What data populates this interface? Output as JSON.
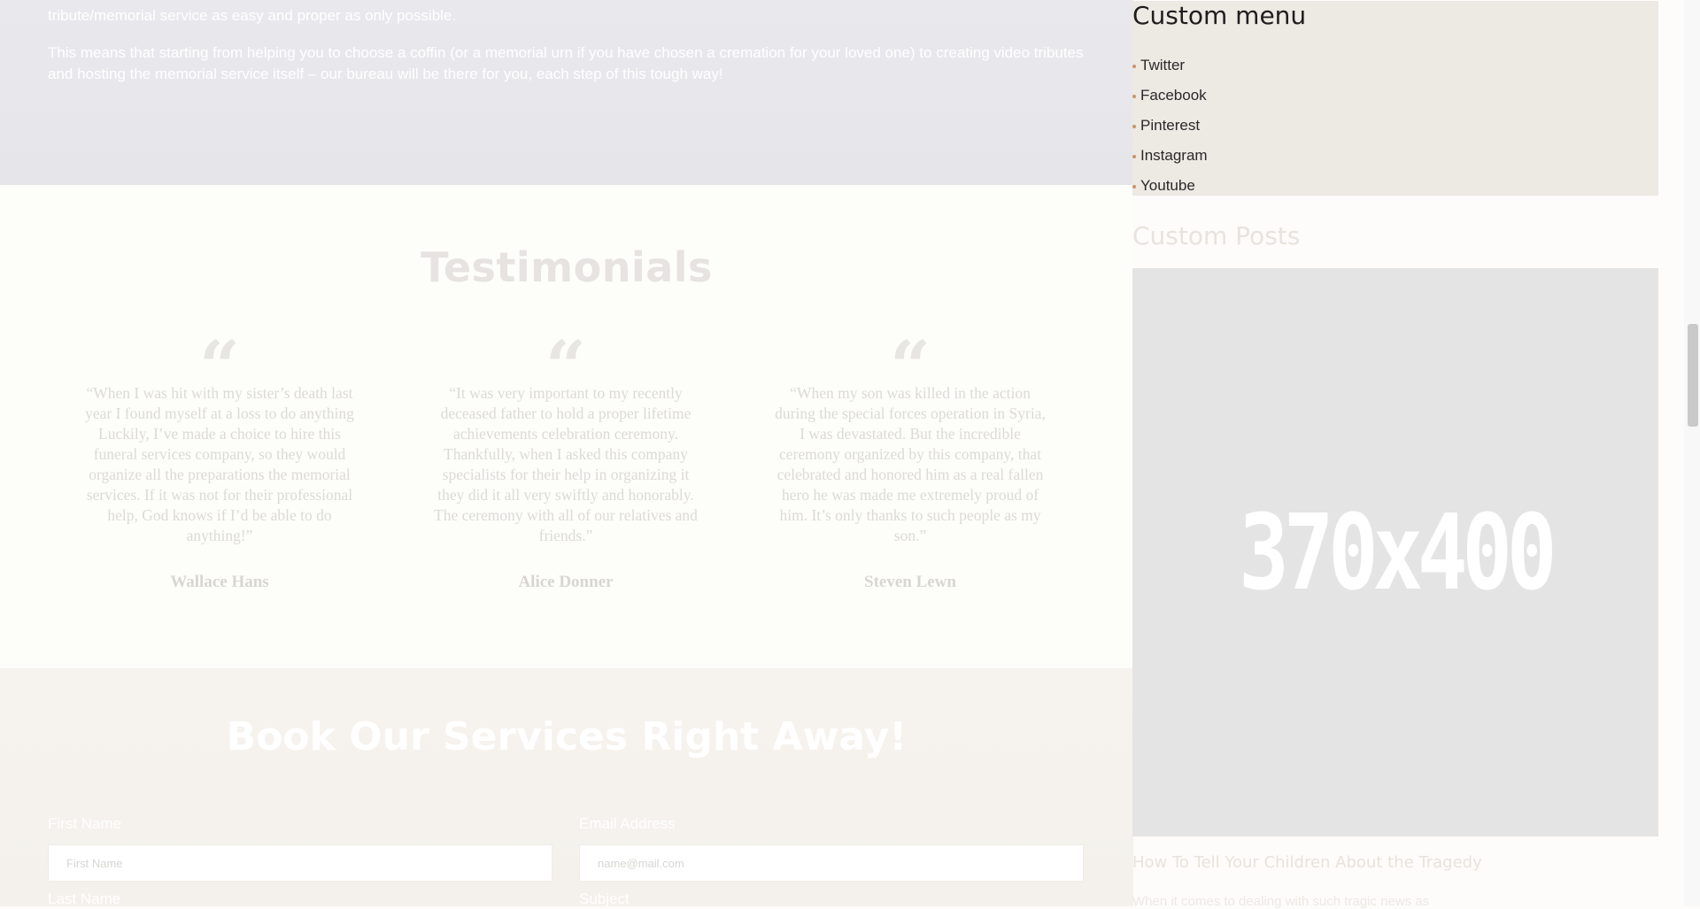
{
  "hero": {
    "paragraph_1": "tribute/memorial service as easy and proper as only possible.",
    "paragraph_2": "This means that starting from helping you to choose a coffin (or a memorial urn if you have chosen a cremation for your loved one) to creating video tributes and hosting the memorial service itself – our bureau will be there for you, each step of this tough way!"
  },
  "testimonials": {
    "title": "Testimonials",
    "quote_icon": "quote-open-icon",
    "items": [
      {
        "text": "“When I was hit with my sister’s death last year I found myself at a loss to do anything Luckily, I’ve made a choice to hire this funeral services company, so they would organize all the preparations the memorial services. If it was not for their professional help, God knows if I’d be able to do anything!”",
        "name": "Wallace Hans"
      },
      {
        "text": "“It was very important to my recently deceased father to hold a proper lifetime achievements celebration ceremony. Thankfully, when I asked this company specialists for their help in organizing it they did it all very swiftly and honorably. The ceremony with all of our relatives and friends.”",
        "name": "Alice Donner"
      },
      {
        "text": "“When my son was killed in the action during the special forces operation in Syria, I was devastated. But the incredible ceremony organized by this company, that celebrated and honored him as a real fallen hero he was made me extremely proud of him. It’s only thanks to such people as my son.”",
        "name": "Steven Lewn"
      }
    ]
  },
  "booking": {
    "title": "Book Our Services Right Away!",
    "first_name_label": "First Name",
    "first_name_placeholder": "First Name",
    "email_label": "Email Address",
    "email_placeholder": "name@mail.com",
    "last_name_label": "Last Name",
    "subject_label": "Subject"
  },
  "sidebar": {
    "menu_title": "Custom menu",
    "menu_items": [
      {
        "label": "Twitter"
      },
      {
        "label": "Facebook"
      },
      {
        "label": "Pinterest"
      },
      {
        "label": "Instagram"
      },
      {
        "label": "Youtube"
      }
    ],
    "posts_title": "Custom Posts",
    "post": {
      "image_placeholder": "370x400",
      "title": "How To Tell Your Children About the Tragedy",
      "excerpt": "When it comes to dealing with such tragic news as"
    }
  },
  "colors": {
    "accent_dot": "#c8956a",
    "menu_background": "#ede9e3",
    "hero_background": "#e8e8ec"
  }
}
